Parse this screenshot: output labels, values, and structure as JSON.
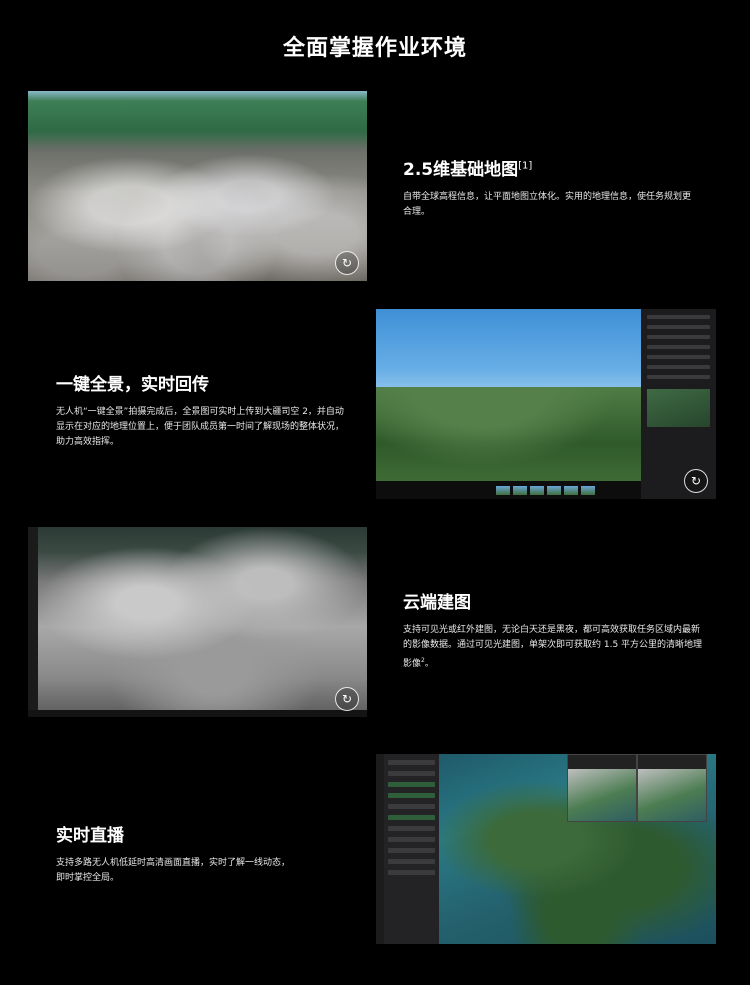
{
  "page": {
    "title": "全面掌握作业环境"
  },
  "features": [
    {
      "title": "2.5维基础地图",
      "title_sup": "[1]",
      "desc": "自带全球高程信息，让平面地图立体化。实用的地理信息，使任务规划更合理。"
    },
    {
      "title": "一键全景，实时回传",
      "desc": "无人机“一键全景”拍摄完成后，全景图可实时上传到大疆司空 2，并自动显示在对应的地理位置上，便于团队成员第一时间了解现场的整体状况，助力高效指挥。"
    },
    {
      "title": "云端建图",
      "desc": "支持可见光或红外建图，无论白天还是黑夜，都可高效获取任务区域内最新的影像数据。通过可见光建图，单架次即可获取约 1.5 平方公里的清晰地理影像",
      "desc_sup": "2",
      "desc_tail": "。"
    },
    {
      "title": "实时直播",
      "desc": "支持多路无人机低延时高清画面直播，实时了解一线动态，即时掌控全局。"
    }
  ],
  "icons": {
    "replay": "replay-icon"
  }
}
